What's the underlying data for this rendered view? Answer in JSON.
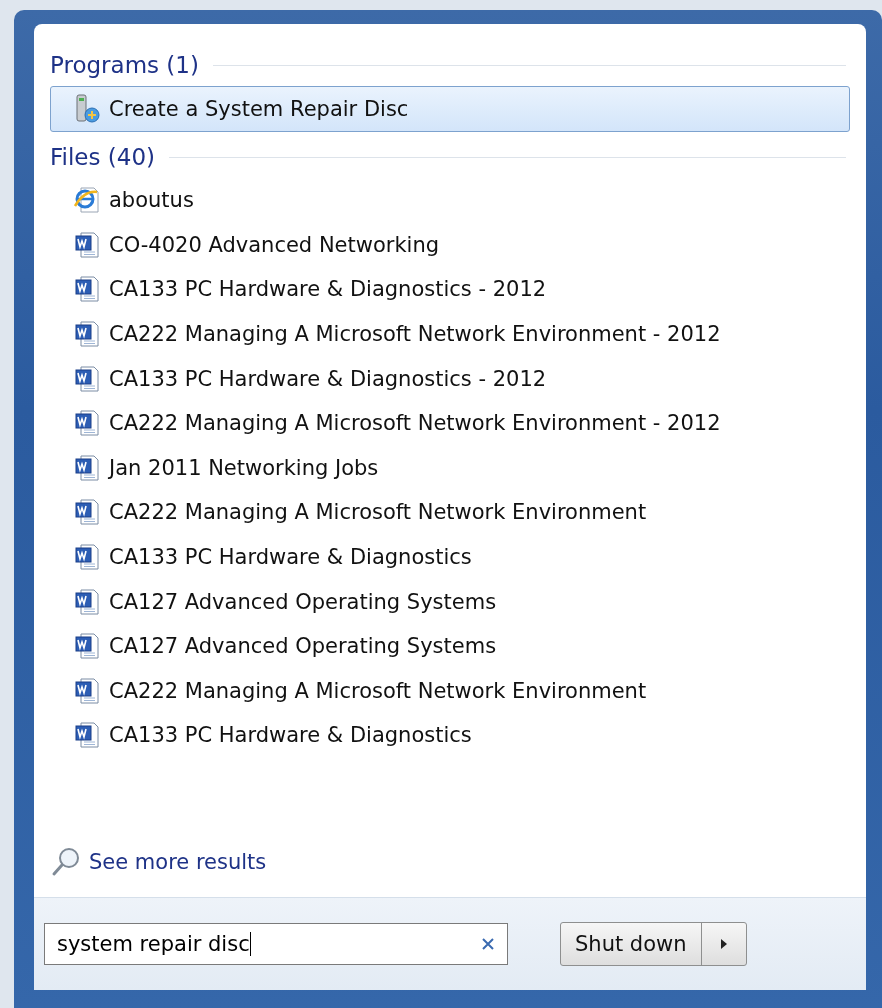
{
  "programs": {
    "title": "Programs (1)",
    "items": [
      {
        "label": "Create a System Repair Disc",
        "kind": "program",
        "selected": true
      }
    ]
  },
  "files": {
    "title": "Files (40)",
    "items": [
      {
        "label": "aboutus",
        "kind": "web"
      },
      {
        "label": "CO-4020 Advanced Networking",
        "kind": "word"
      },
      {
        "label": "CA133 PC Hardware & Diagnostics - 2012",
        "kind": "word"
      },
      {
        "label": "CA222 Managing A Microsoft Network Environment - 2012",
        "kind": "word"
      },
      {
        "label": "CA133 PC Hardware & Diagnostics - 2012",
        "kind": "word"
      },
      {
        "label": "CA222 Managing A Microsoft Network Environment - 2012",
        "kind": "word"
      },
      {
        "label": "Jan 2011 Networking Jobs",
        "kind": "word"
      },
      {
        "label": "CA222 Managing A Microsoft Network Environment",
        "kind": "word"
      },
      {
        "label": "CA133 PC Hardware & Diagnostics",
        "kind": "word"
      },
      {
        "label": "CA127 Advanced Operating Systems",
        "kind": "word"
      },
      {
        "label": "CA127 Advanced Operating Systems",
        "kind": "word"
      },
      {
        "label": "CA222 Managing A Microsoft Network Environment",
        "kind": "word"
      },
      {
        "label": "CA133 PC Hardware & Diagnostics",
        "kind": "word"
      }
    ]
  },
  "see_more": "See more results",
  "search": {
    "value": "system repair disc"
  },
  "shutdown": {
    "label": "Shut down"
  }
}
